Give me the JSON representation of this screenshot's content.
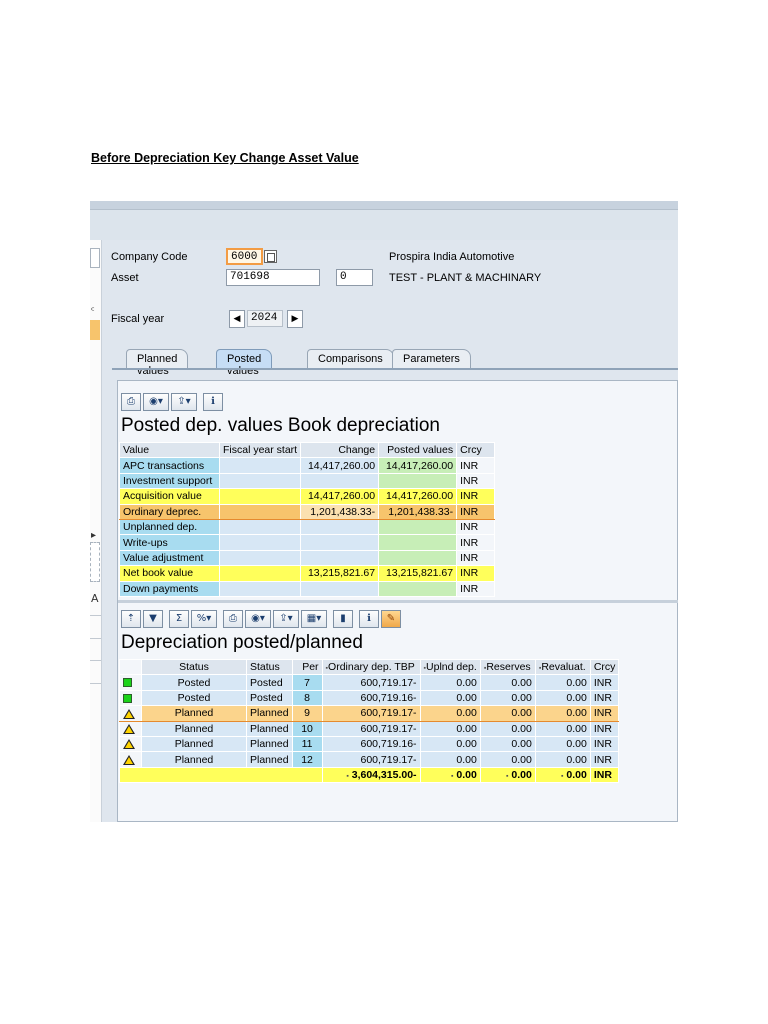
{
  "document": {
    "heading": "Before Depreciation Key Change Asset Value"
  },
  "header": {
    "company_code_label": "Company Code",
    "company_code_value": "6000",
    "company_name": "Prospira India Automotive",
    "asset_label": "Asset",
    "asset_value": "701698",
    "sub_number": "0",
    "asset_description": "TEST - PLANT & MACHINARY",
    "fiscal_year_label": "Fiscal year",
    "fiscal_year_value": "2024"
  },
  "tabs": [
    "Planned values",
    "Posted values",
    "Comparisons",
    "Parameters"
  ],
  "active_tab": "Posted values",
  "posted_panel": {
    "title": "Posted dep. values Book depreciation",
    "columns": [
      "Value",
      "Fiscal year start",
      "Change",
      "Posted values",
      "Crcy"
    ],
    "rows": [
      {
        "label": "APC transactions",
        "fy_start": "",
        "change": "14,417,260.00",
        "posted": "14,417,260.00",
        "crcy": "INR"
      },
      {
        "label": "Investment support",
        "fy_start": "",
        "change": "",
        "posted": "",
        "crcy": "INR"
      },
      {
        "label": "Acquisition value",
        "fy_start": "",
        "change": "14,417,260.00",
        "posted": "14,417,260.00",
        "crcy": "INR"
      },
      {
        "label": "Ordinary deprec.",
        "fy_start": "",
        "change": "1,201,438.33-",
        "posted": "1,201,438.33-",
        "crcy": "INR"
      },
      {
        "label": "Unplanned dep.",
        "fy_start": "",
        "change": "",
        "posted": "",
        "crcy": "INR"
      },
      {
        "label": "Write-ups",
        "fy_start": "",
        "change": "",
        "posted": "",
        "crcy": "INR"
      },
      {
        "label": "Value adjustment",
        "fy_start": "",
        "change": "",
        "posted": "",
        "crcy": "INR"
      },
      {
        "label": "Net book value",
        "fy_start": "",
        "change": "13,215,821.67",
        "posted": "13,215,821.67",
        "crcy": "INR"
      },
      {
        "label": "Down payments",
        "fy_start": "",
        "change": "",
        "posted": "",
        "crcy": "INR"
      }
    ]
  },
  "dep_panel": {
    "title": "Depreciation posted/planned",
    "columns": [
      "Status",
      "Status",
      "Per",
      "Ordinary dep. TBP",
      "Uplnd dep.",
      "Reserves",
      "Revaluat.",
      "Crcy"
    ],
    "rows": [
      {
        "icon": "green-square-icon",
        "status": "Posted",
        "status2": "Posted",
        "per": "7",
        "ord": "600,719.17-",
        "unpl": "0.00",
        "res": "0.00",
        "reval": "0.00",
        "crcy": "INR"
      },
      {
        "icon": "green-square-icon",
        "status": "Posted",
        "status2": "Posted",
        "per": "8",
        "ord": "600,719.16-",
        "unpl": "0.00",
        "res": "0.00",
        "reval": "0.00",
        "crcy": "INR"
      },
      {
        "icon": "warning-triangle-icon",
        "status": "Planned",
        "status2": "Planned",
        "per": "9",
        "ord": "600,719.17-",
        "unpl": "0.00",
        "res": "0.00",
        "reval": "0.00",
        "crcy": "INR"
      },
      {
        "icon": "warning-triangle-icon",
        "status": "Planned",
        "status2": "Planned",
        "per": "10",
        "ord": "600,719.17-",
        "unpl": "0.00",
        "res": "0.00",
        "reval": "0.00",
        "crcy": "INR"
      },
      {
        "icon": "warning-triangle-icon",
        "status": "Planned",
        "status2": "Planned",
        "per": "11",
        "ord": "600,719.16-",
        "unpl": "0.00",
        "res": "0.00",
        "reval": "0.00",
        "crcy": "INR"
      },
      {
        "icon": "warning-triangle-icon",
        "status": "Planned",
        "status2": "Planned",
        "per": "12",
        "ord": "600,719.17-",
        "unpl": "0.00",
        "res": "0.00",
        "reval": "0.00",
        "crcy": "INR"
      }
    ],
    "total": {
      "ord": "3,604,315.00-",
      "unpl": "0.00",
      "res": "0.00",
      "reval": "0.00",
      "crcy": "INR"
    },
    "sum_mark": "▪"
  }
}
